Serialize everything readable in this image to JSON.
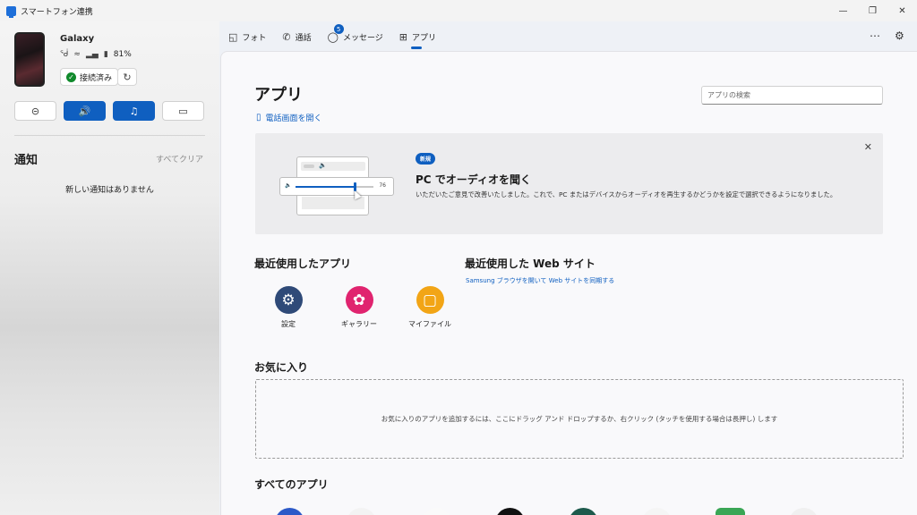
{
  "window": {
    "title": "スマートフォン連携"
  },
  "device": {
    "name": "Galaxy",
    "battery": "81%",
    "connected_label": "接続済み"
  },
  "notifications": {
    "title": "通知",
    "clear_all": "すべてクリア",
    "empty_text": "新しい通知はありません"
  },
  "tabs": [
    {
      "label": "フォト",
      "icon": "photo-icon"
    },
    {
      "label": "通話",
      "icon": "phone-icon"
    },
    {
      "label": "メッセージ",
      "icon": "message-icon",
      "badge": "5"
    },
    {
      "label": "アプリ",
      "icon": "apps-icon",
      "active": true
    }
  ],
  "main": {
    "title": "アプリ",
    "search_placeholder": "アプリの検索",
    "open_phone_screen": "電話画面を開く",
    "banner": {
      "badge": "新規",
      "title": "PC でオーディオを聞く",
      "description": "いただいたご意見で改善いたしました。これで、PC またはデバイスからオーディオを再生するかどうかを設定で選択できるようになりました。",
      "illustration_volume": "76",
      "illustration_level": 0.76
    },
    "recent_apps_title": "最近使用したアプリ",
    "recent_apps": [
      {
        "label": "設定",
        "icon": "gear-icon",
        "color": "#2f4a78"
      },
      {
        "label": "ギャラリー",
        "icon": "flower-icon",
        "color": "#e0246f"
      },
      {
        "label": "マイファイル",
        "icon": "folder-icon",
        "color": "#f2a516"
      }
    ],
    "recent_web_title": "最近使用した Web サイト",
    "recent_web_link": "Samsung ブラウザを開いて Web サイトを同期する",
    "favorites_title": "お気に入り",
    "favorites_hint": "お気に入りのアプリを追加するには、ここにドラッグ アンド ドロップするか、右クリック (タッチを使用する場合は長押し) します",
    "all_apps_title": "すべてのアプリ"
  },
  "colors": {
    "accent": "#0f5fc0",
    "connected": "#108a2c"
  }
}
